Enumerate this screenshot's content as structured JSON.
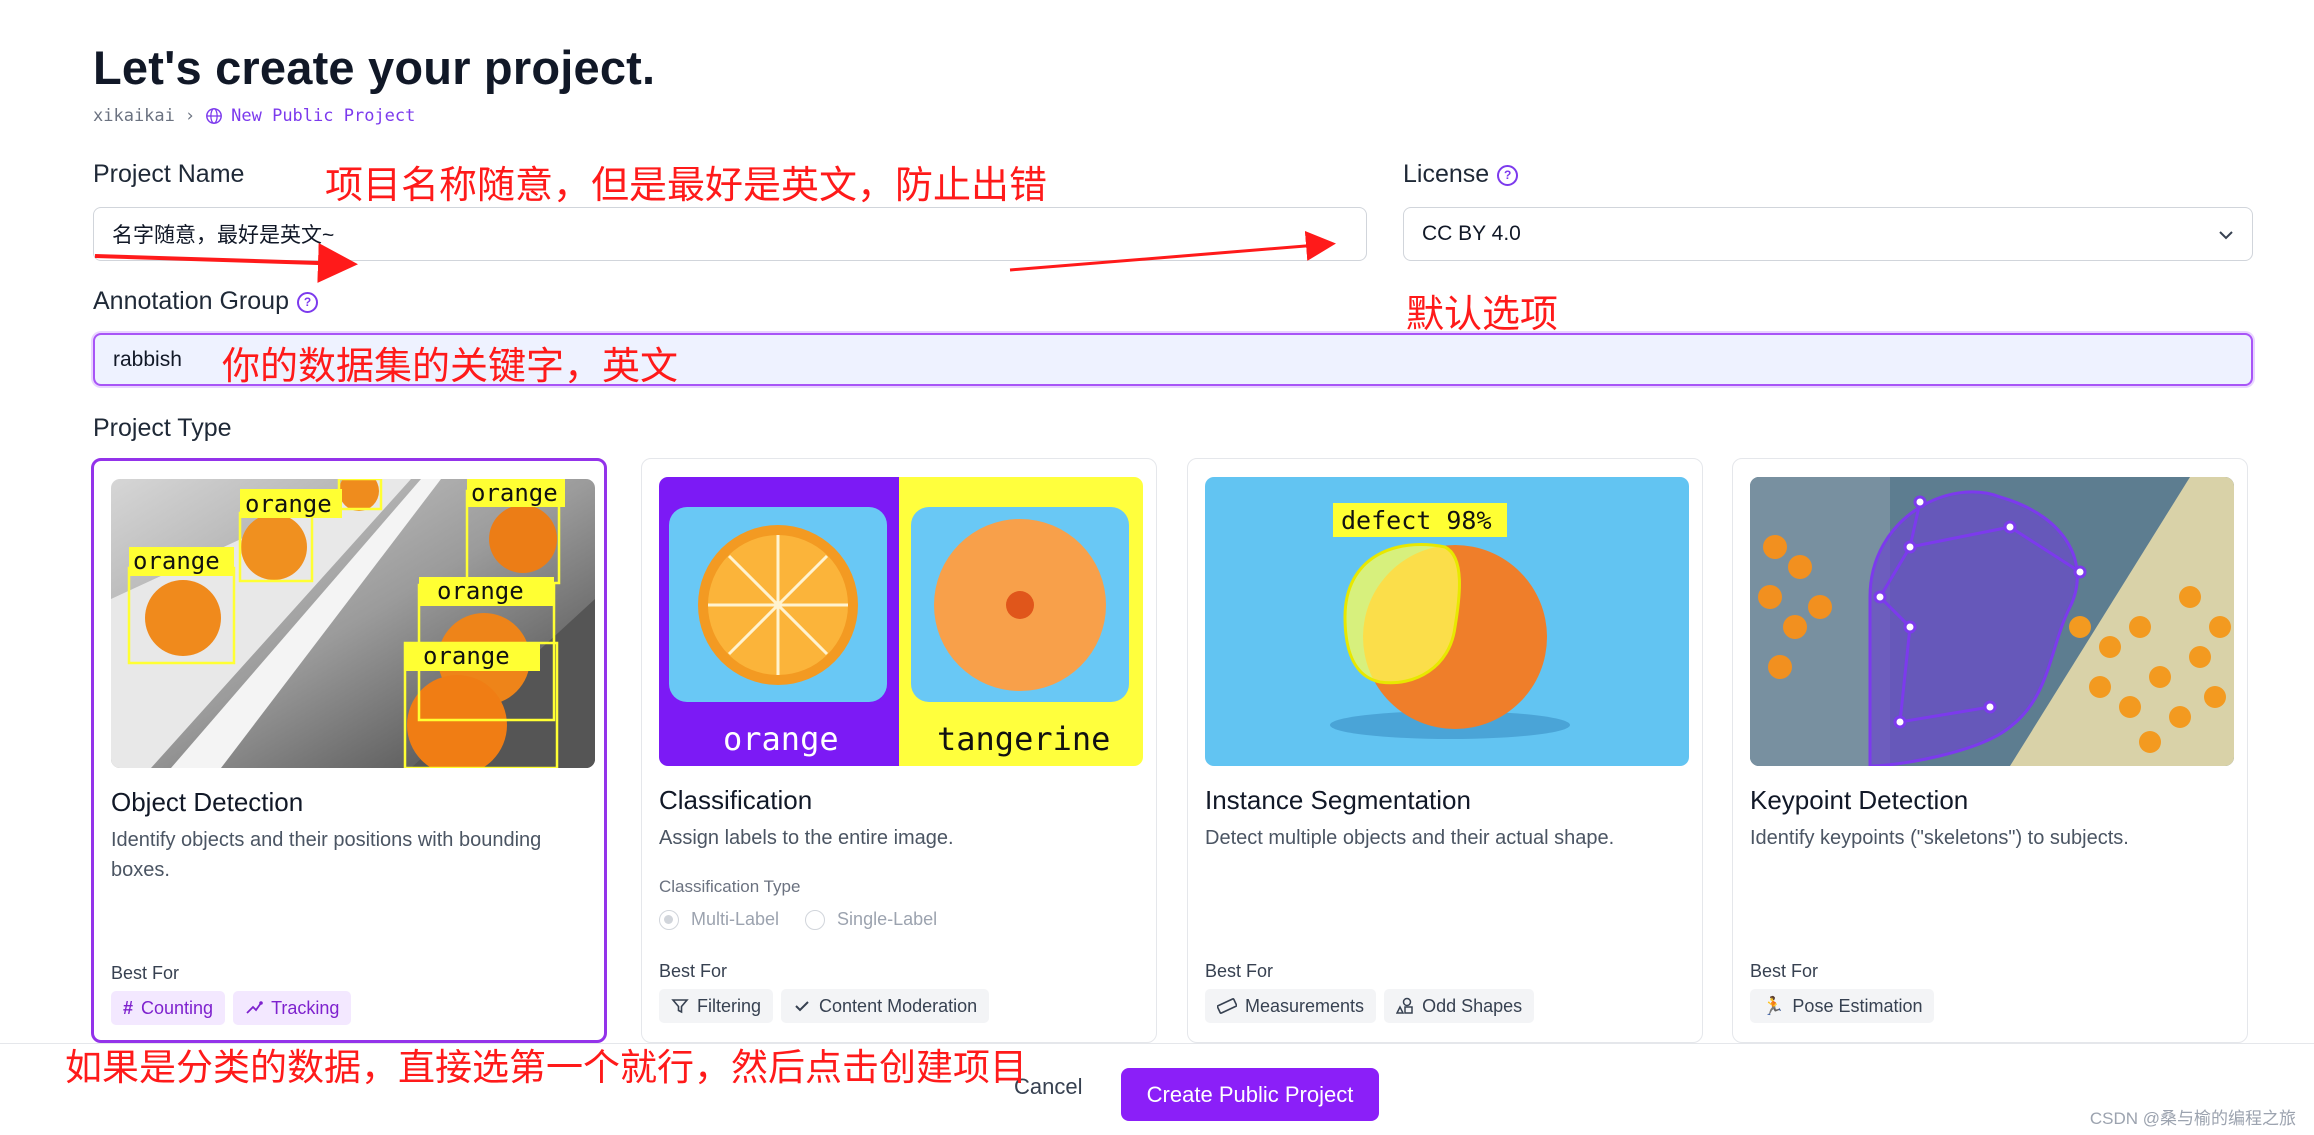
{
  "page": {
    "title": "Let's create your project."
  },
  "breadcrumb": {
    "user": "xikaikai",
    "separator": "›",
    "project": "New Public Project"
  },
  "project_name": {
    "label": "Project Name",
    "value": "名字随意，最好是英文~"
  },
  "license": {
    "label": "License",
    "value": "CC BY 4.0"
  },
  "annotation_group": {
    "label": "Annotation Group",
    "value": "rabbish"
  },
  "project_type": {
    "label": "Project Type"
  },
  "cards": [
    {
      "title": "Object Detection",
      "desc": "Identify objects and their positions with bounding boxes.",
      "best_for": "Best For",
      "tags": [
        "Counting",
        "Tracking"
      ],
      "image_labels": [
        "orange",
        "orange",
        "orange",
        "orange"
      ]
    },
    {
      "title": "Classification",
      "desc": "Assign labels to the entire image.",
      "best_for": "Best For",
      "classification_type": "Classification Type",
      "options": [
        "Multi-Label",
        "Single-Label"
      ],
      "tags": [
        "Filtering",
        "Content Moderation"
      ],
      "image_labels": [
        "orange",
        "tangerine"
      ]
    },
    {
      "title": "Instance Segmentation",
      "desc": "Detect multiple objects and their actual shape.",
      "best_for": "Best For",
      "tags": [
        "Measurements",
        "Odd Shapes"
      ],
      "image_labels": [
        "defect 98%"
      ]
    },
    {
      "title": "Keypoint Detection",
      "desc": "Identify keypoints (\"skeletons\") to subjects.",
      "best_for": "Best For",
      "tags": [
        "Pose Estimation"
      ]
    }
  ],
  "footer": {
    "cancel": "Cancel",
    "create": "Create Public Project"
  },
  "annotations": {
    "name_note": "项目名称随意，但是最好是英文，防止出错",
    "license_note": "默认选项",
    "group_note": "你的数据集的关键字，英文",
    "type_note": "如果是分类的数据，直接选第一个就行，然后点击创建项目"
  },
  "watermark": "CSDN @桑与榆的编程之旅",
  "colors": {
    "accent": "#8b1ff8",
    "annotation": "#ff1a1a",
    "selected_border": "#9333ea"
  },
  "icons": [
    "globe-icon",
    "help-icon",
    "chevron-down-icon",
    "hash-icon",
    "tracking-icon",
    "filter-icon",
    "check-icon",
    "ruler-icon",
    "shapes-icon",
    "running-icon"
  ]
}
